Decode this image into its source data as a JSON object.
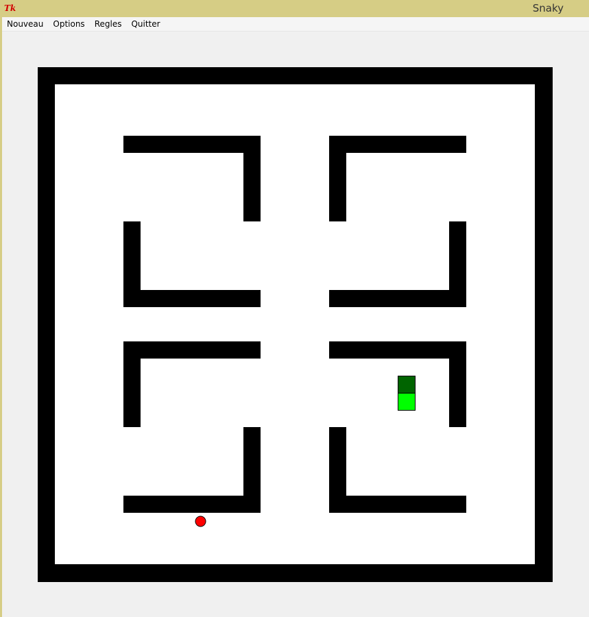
{
  "app": {
    "icon": "tk-feather-icon",
    "icon_text": "Tk",
    "title": "Snaky"
  },
  "menu": {
    "items": [
      "Nouveau",
      "Options",
      "Regles",
      "Quitter"
    ]
  },
  "colors": {
    "wall": "#000000",
    "floor": "#ffffff",
    "snake_head": "#006400",
    "snake_body": "#00ff00",
    "food": "#ff0000"
  },
  "game": {
    "grid_cells": 30,
    "walls": [
      [
        0,
        0,
        30,
        1
      ],
      [
        0,
        29,
        30,
        1
      ],
      [
        0,
        0,
        1,
        30
      ],
      [
        29,
        0,
        1,
        30
      ],
      [
        5,
        4,
        8,
        1
      ],
      [
        12,
        4,
        1,
        5
      ],
      [
        17,
        4,
        8,
        1
      ],
      [
        17,
        4,
        1,
        5
      ],
      [
        5,
        9,
        1,
        5
      ],
      [
        5,
        13,
        8,
        1
      ],
      [
        24,
        9,
        1,
        5
      ],
      [
        17,
        13,
        8,
        1
      ],
      [
        5,
        16,
        8,
        1
      ],
      [
        5,
        16,
        1,
        5
      ],
      [
        17,
        16,
        8,
        1
      ],
      [
        24,
        16,
        1,
        5
      ],
      [
        12,
        21,
        1,
        5
      ],
      [
        5,
        25,
        8,
        1
      ],
      [
        17,
        21,
        1,
        5
      ],
      [
        17,
        25,
        8,
        1
      ]
    ],
    "snake": [
      [
        21,
        18
      ],
      [
        21,
        19
      ]
    ],
    "food": [
      9.5,
      26.5
    ]
  }
}
